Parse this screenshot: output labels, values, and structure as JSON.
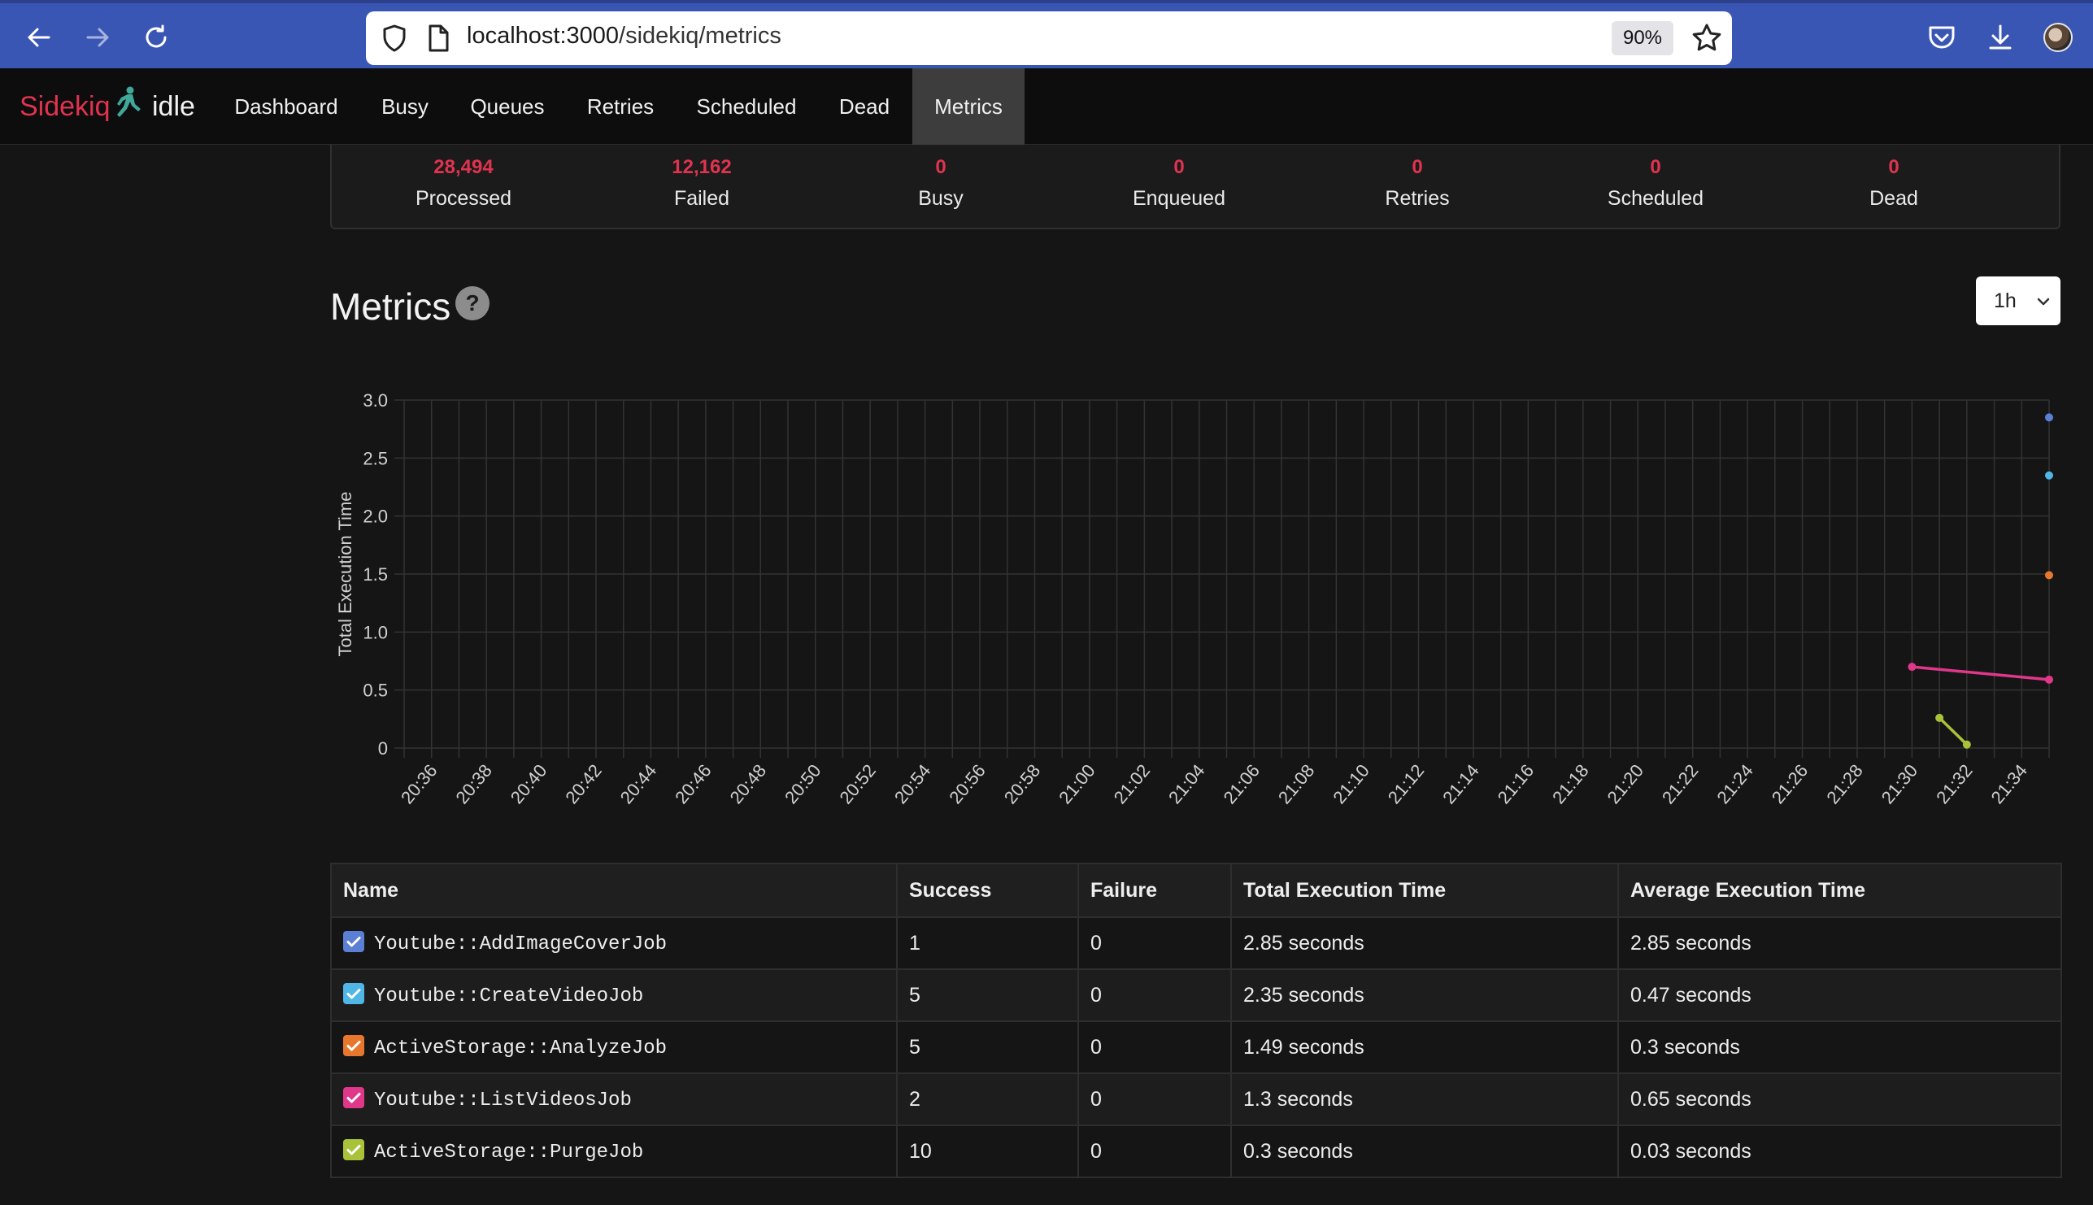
{
  "browser": {
    "url_host": "localhost:3000",
    "url_path": "/sidekiq/metrics",
    "zoom": "90%"
  },
  "navbar": {
    "brand": "Sidekiq",
    "status": "idle",
    "items": [
      {
        "label": "Dashboard"
      },
      {
        "label": "Busy"
      },
      {
        "label": "Queues"
      },
      {
        "label": "Retries"
      },
      {
        "label": "Scheduled"
      },
      {
        "label": "Dead"
      },
      {
        "label": "Metrics",
        "active": true
      }
    ]
  },
  "summary": [
    {
      "value": "28,494",
      "label": "Processed"
    },
    {
      "value": "12,162",
      "label": "Failed"
    },
    {
      "value": "0",
      "label": "Busy"
    },
    {
      "value": "0",
      "label": "Enqueued"
    },
    {
      "value": "0",
      "label": "Retries"
    },
    {
      "value": "0",
      "label": "Scheduled"
    },
    {
      "value": "0",
      "label": "Dead"
    }
  ],
  "metrics": {
    "title": "Metrics",
    "help": "?",
    "period": "1h"
  },
  "chart_data": {
    "type": "line",
    "ylabel": "Total Execution Time",
    "xlabel": "",
    "ylim": [
      0,
      3.0
    ],
    "y_ticks": [
      "0",
      "0.5",
      "1.0",
      "1.5",
      "2.0",
      "2.5",
      "3.0"
    ],
    "x_minutes": [
      "20:35",
      "20:36",
      "20:37",
      "20:38",
      "20:39",
      "20:40",
      "20:41",
      "20:42",
      "20:43",
      "20:44",
      "20:45",
      "20:46",
      "20:47",
      "20:48",
      "20:49",
      "20:50",
      "20:51",
      "20:52",
      "20:53",
      "20:54",
      "20:55",
      "20:56",
      "20:57",
      "20:58",
      "20:59",
      "21:00",
      "21:01",
      "21:02",
      "21:03",
      "21:04",
      "21:05",
      "21:06",
      "21:07",
      "21:08",
      "21:09",
      "21:10",
      "21:11",
      "21:12",
      "21:13",
      "21:14",
      "21:15",
      "21:16",
      "21:17",
      "21:18",
      "21:19",
      "21:20",
      "21:21",
      "21:22",
      "21:23",
      "21:24",
      "21:25",
      "21:26",
      "21:27",
      "21:28",
      "21:29",
      "21:30",
      "21:31",
      "21:32",
      "21:33",
      "21:34",
      "21:35"
    ],
    "x_tick_labels": [
      "20:36",
      "20:38",
      "20:40",
      "20:42",
      "20:44",
      "20:46",
      "20:48",
      "20:50",
      "20:52",
      "20:54",
      "20:56",
      "20:58",
      "21:00",
      "21:02",
      "21:04",
      "21:06",
      "21:08",
      "21:10",
      "21:12",
      "21:14",
      "21:16",
      "21:18",
      "21:20",
      "21:22",
      "21:24",
      "21:26",
      "21:28",
      "21:30",
      "21:32",
      "21:34"
    ],
    "grid": true,
    "series": [
      {
        "name": "Youtube::AddImageCoverJob",
        "color": "#5a7fd4",
        "points": [
          {
            "x": "21:35",
            "y": 2.85
          }
        ]
      },
      {
        "name": "Youtube::CreateVideoJob",
        "color": "#4fb6e6",
        "points": [
          {
            "x": "21:35",
            "y": 2.35
          }
        ]
      },
      {
        "name": "ActiveStorage::AnalyzeJob",
        "color": "#e8772e",
        "points": [
          {
            "x": "21:35",
            "y": 1.49
          }
        ]
      },
      {
        "name": "Youtube::ListVideosJob",
        "color": "#e0378a",
        "points": [
          {
            "x": "21:30",
            "y": 0.7
          },
          {
            "x": "21:35",
            "y": 0.59
          }
        ]
      },
      {
        "name": "ActiveStorage::PurgeJob",
        "color": "#a8c23a",
        "points": [
          {
            "x": "21:31",
            "y": 0.26
          },
          {
            "x": "21:32",
            "y": 0.03
          }
        ]
      }
    ]
  },
  "table": {
    "headers": [
      "Name",
      "Success",
      "Failure",
      "Total Execution Time",
      "Average Execution Time"
    ],
    "rows": [
      {
        "name": "Youtube::AddImageCoverJob",
        "color": "#5a7fd4",
        "success": "1",
        "failure": "0",
        "total": "2.85 seconds",
        "average": "2.85 seconds"
      },
      {
        "name": "Youtube::CreateVideoJob",
        "color": "#4fb6e6",
        "success": "5",
        "failure": "0",
        "total": "2.35 seconds",
        "average": "0.47 seconds"
      },
      {
        "name": "ActiveStorage::AnalyzeJob",
        "color": "#e8772e",
        "success": "5",
        "failure": "0",
        "total": "1.49 seconds",
        "average": "0.3 seconds"
      },
      {
        "name": "Youtube::ListVideosJob",
        "color": "#e0378a",
        "success": "2",
        "failure": "0",
        "total": "1.3 seconds",
        "average": "0.65 seconds"
      },
      {
        "name": "ActiveStorage::PurgeJob",
        "color": "#a8c23a",
        "success": "10",
        "failure": "0",
        "total": "0.3 seconds",
        "average": "0.03 seconds"
      }
    ]
  },
  "colors": {
    "brand_red": "#e0334f",
    "browser_bar": "#3a56b4",
    "background": "#151515"
  }
}
